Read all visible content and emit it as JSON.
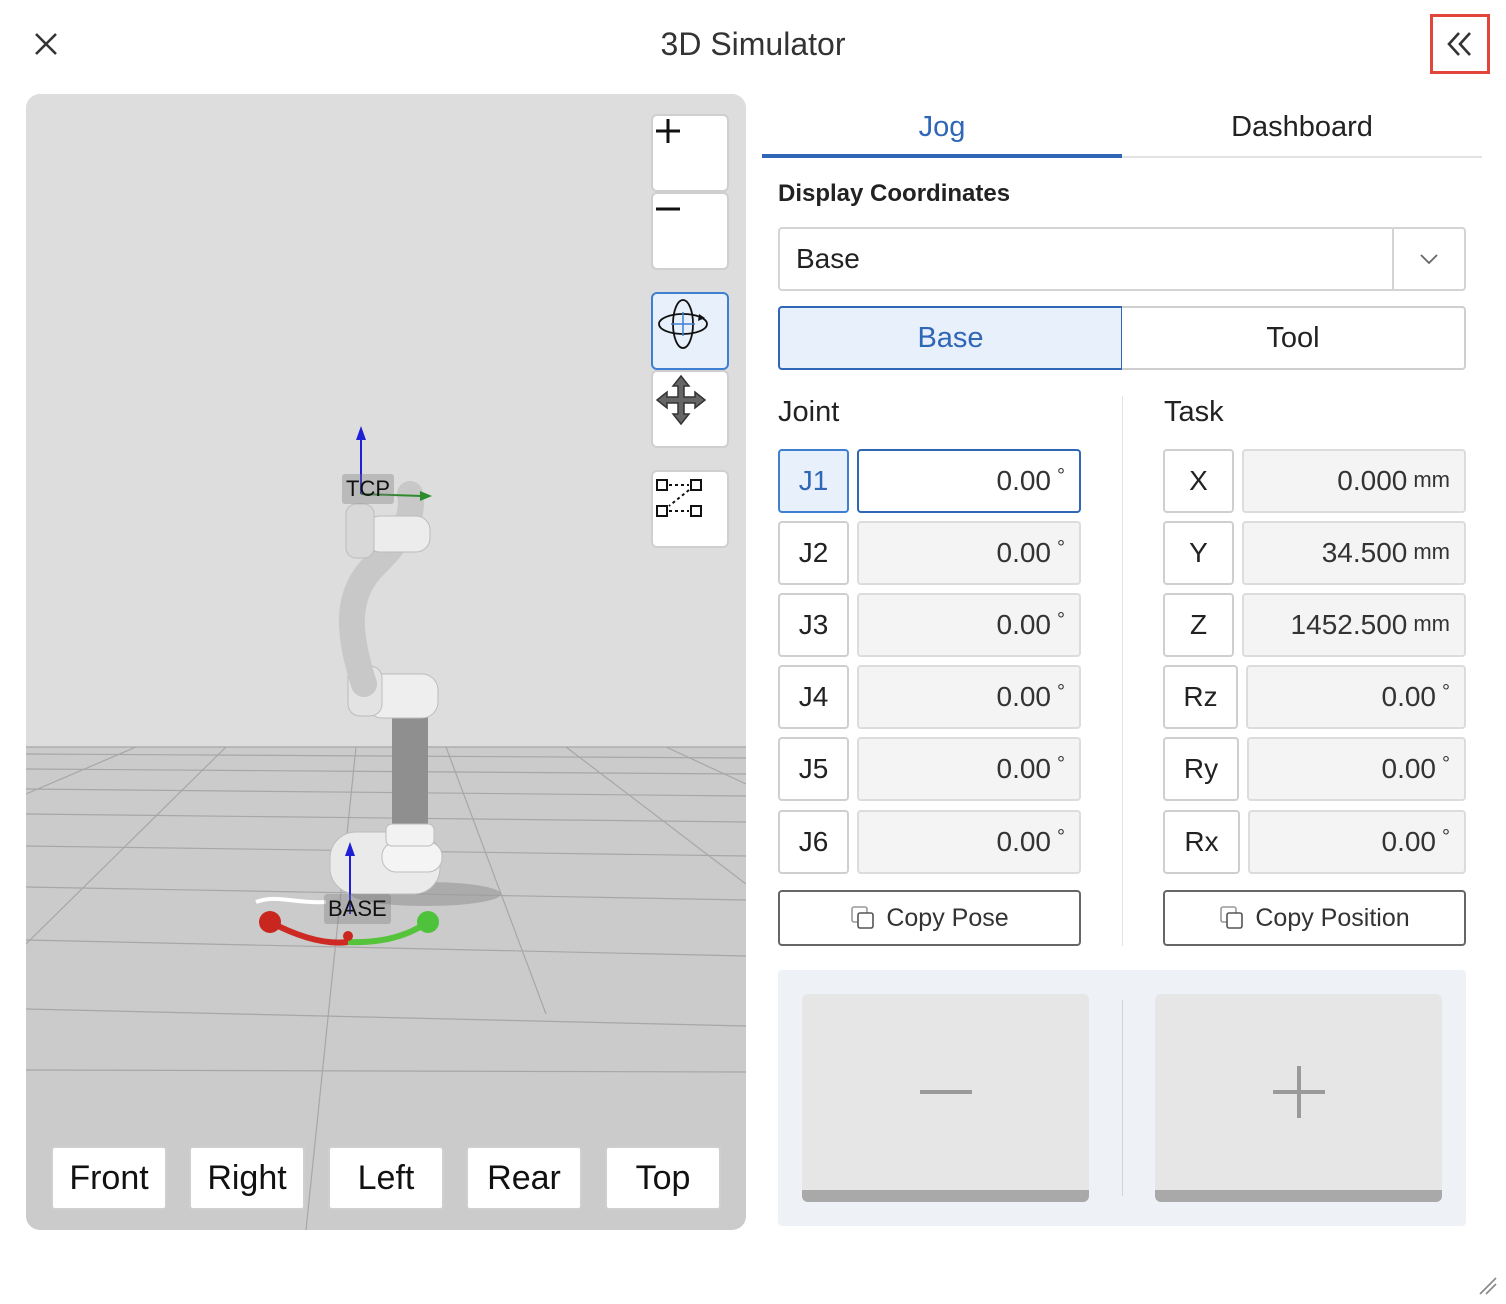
{
  "header": {
    "title": "3D Simulator",
    "close_icon": "close-icon",
    "collapse_icon": "double-chevron-left-icon",
    "highlight_color": "#e2463a"
  },
  "viewport": {
    "tools": [
      "zoom-in-icon",
      "zoom-out-icon",
      "orbit-rotate-icon",
      "pan-move-icon",
      "fit-view-icon"
    ],
    "active_tool": "orbit-rotate-icon",
    "scene_labels": {
      "tcp": "TCP",
      "base": "BASE"
    },
    "view_buttons": [
      "Front",
      "Right",
      "Left",
      "Rear",
      "Top"
    ]
  },
  "panel": {
    "tabs": [
      {
        "label": "Jog",
        "active": true
      },
      {
        "label": "Dashboard",
        "active": false
      }
    ],
    "display_coordinates": {
      "label": "Display Coordinates",
      "selected": "Base"
    },
    "frame_toggle": [
      {
        "label": "Base",
        "active": true
      },
      {
        "label": "Tool",
        "active": false
      }
    ],
    "joint": {
      "heading": "Joint",
      "unit": "°",
      "rows": [
        {
          "axis": "J1",
          "value": "0.00"
        },
        {
          "axis": "J2",
          "value": "0.00"
        },
        {
          "axis": "J3",
          "value": "0.00"
        },
        {
          "axis": "J4",
          "value": "0.00"
        },
        {
          "axis": "J5",
          "value": "0.00"
        },
        {
          "axis": "J6",
          "value": "0.00"
        }
      ],
      "active_axis": "J1",
      "copy_label": "Copy Pose"
    },
    "task": {
      "heading": "Task",
      "rows": [
        {
          "axis": "X",
          "value": "0.000",
          "unit": "mm"
        },
        {
          "axis": "Y",
          "value": "34.500",
          "unit": "mm"
        },
        {
          "axis": "Z",
          "value": "1452.500",
          "unit": "mm"
        },
        {
          "axis": "Rz",
          "value": "0.00",
          "unit": "°"
        },
        {
          "axis": "Ry",
          "value": "0.00",
          "unit": "°"
        },
        {
          "axis": "Rx",
          "value": "0.00",
          "unit": "°"
        }
      ],
      "copy_label": "Copy Position"
    },
    "jog_pad": {
      "minus_icon": "minus-icon",
      "plus_icon": "plus-icon"
    },
    "accent_color": "#2f66b5"
  }
}
